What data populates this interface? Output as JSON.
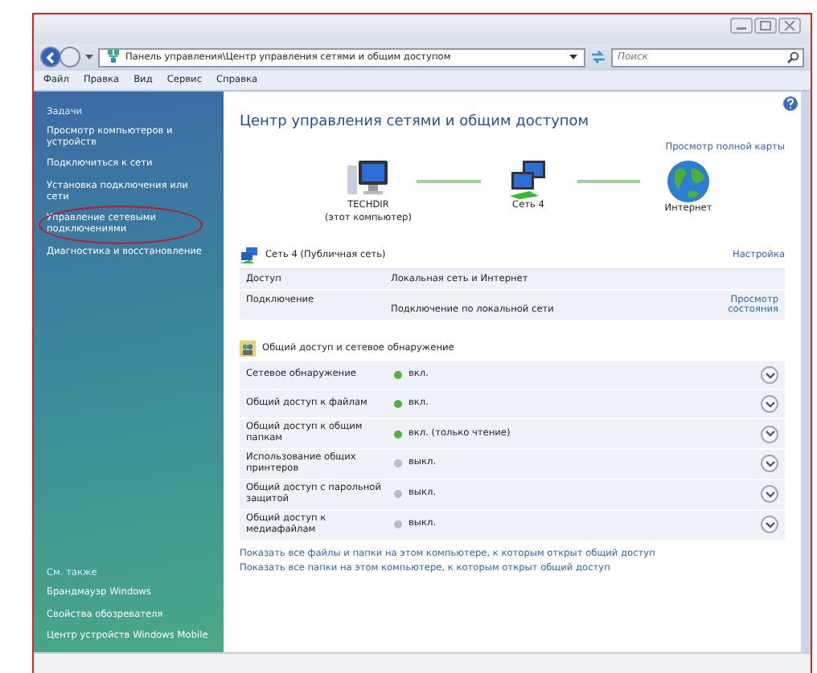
{
  "address_bar": {
    "path": "Панель управления\\Центр управления сетями и общим доступом",
    "search_placeholder": "Поиск"
  },
  "menu": [
    "Файл",
    "Правка",
    "Вид",
    "Сервис",
    "Справка"
  ],
  "sidebar": {
    "tasks_title": "Задачи",
    "tasks": [
      {
        "label": "Просмотр компьютеров и устройств",
        "circled": false
      },
      {
        "label": "Подключиться к сети",
        "circled": false
      },
      {
        "label": "Установка подключения или сети",
        "circled": false
      },
      {
        "label": "Управление сетевыми подключениями",
        "circled": true
      },
      {
        "label": "Диагностика и восстановление",
        "circled": false
      }
    ],
    "see_also_title": "См. также",
    "see_also": [
      "Брандмауэр Windows",
      "Свойства обозревателя",
      "Центр устройств Windows Mobile"
    ]
  },
  "content": {
    "title": "Центр управления сетями и общим доступом",
    "full_map_link": "Просмотр полной карты",
    "map": [
      {
        "kind": "computer",
        "label": "TECHDIR",
        "sublabel": "(этот компьютер)"
      },
      {
        "kind": "network",
        "label": "Сеть 4"
      },
      {
        "kind": "internet",
        "label": "Интернет"
      }
    ],
    "network": {
      "title": "Сеть  4 (Публичная сеть)",
      "settings_link": "Настройка",
      "rows": [
        {
          "label": "Доступ",
          "value": "Локальная сеть и Интернет"
        },
        {
          "label": "Подключение",
          "value": "Подключение по локальной сети",
          "link": "Просмотр состояния"
        }
      ]
    },
    "sharing": {
      "title": "Общий доступ и сетевое обнаружение",
      "rows": [
        {
          "label": "Сетевое обнаружение",
          "status": "вкл.",
          "on": true
        },
        {
          "label": "Общий доступ к файлам",
          "status": "вкл.",
          "on": true
        },
        {
          "label": "Общий доступ к общим папкам",
          "status": "вкл. (только чтение)",
          "on": true
        },
        {
          "label": "Использование общих принтеров",
          "status": "выкл.",
          "on": false
        },
        {
          "label": "Общий доступ с парольной защитой",
          "status": "выкл.",
          "on": false
        },
        {
          "label": "Общий доступ к медиафайлам",
          "status": "выкл.",
          "on": false
        }
      ]
    },
    "links": [
      "Показать все файлы и папки на этом компьютере, к которым открыт общий доступ",
      "Показать все папки на этом компьютере, к которым открыт общий доступ"
    ]
  }
}
